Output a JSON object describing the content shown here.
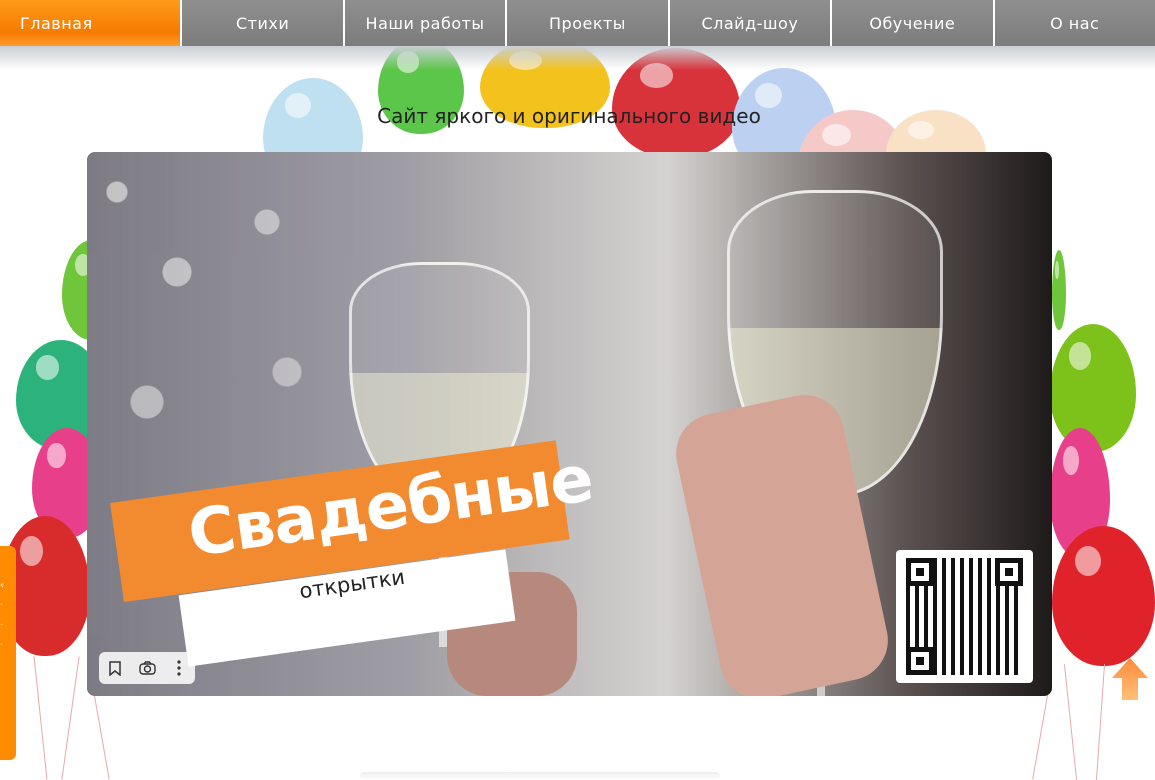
{
  "nav": {
    "items": [
      {
        "label": "Главная",
        "active": true
      },
      {
        "label": "Стихи"
      },
      {
        "label": "Наши работы"
      },
      {
        "label": "Проекты"
      },
      {
        "label": "Слайд-шоу"
      },
      {
        "label": "Обучение"
      },
      {
        "label": "О нас"
      }
    ]
  },
  "page": {
    "site_title": "Сайт яркого и оригинального видео"
  },
  "video": {
    "title_big": "Свадебные",
    "title_small": "открытки",
    "controls": [
      {
        "icon": "bookmark-icon"
      },
      {
        "icon": "camera-icon"
      },
      {
        "icon": "more-vertical-icon"
      }
    ]
  },
  "colors": {
    "accent": "#f57c00",
    "nav_bg": "#8a8a8a",
    "banner": "#f28a30"
  }
}
